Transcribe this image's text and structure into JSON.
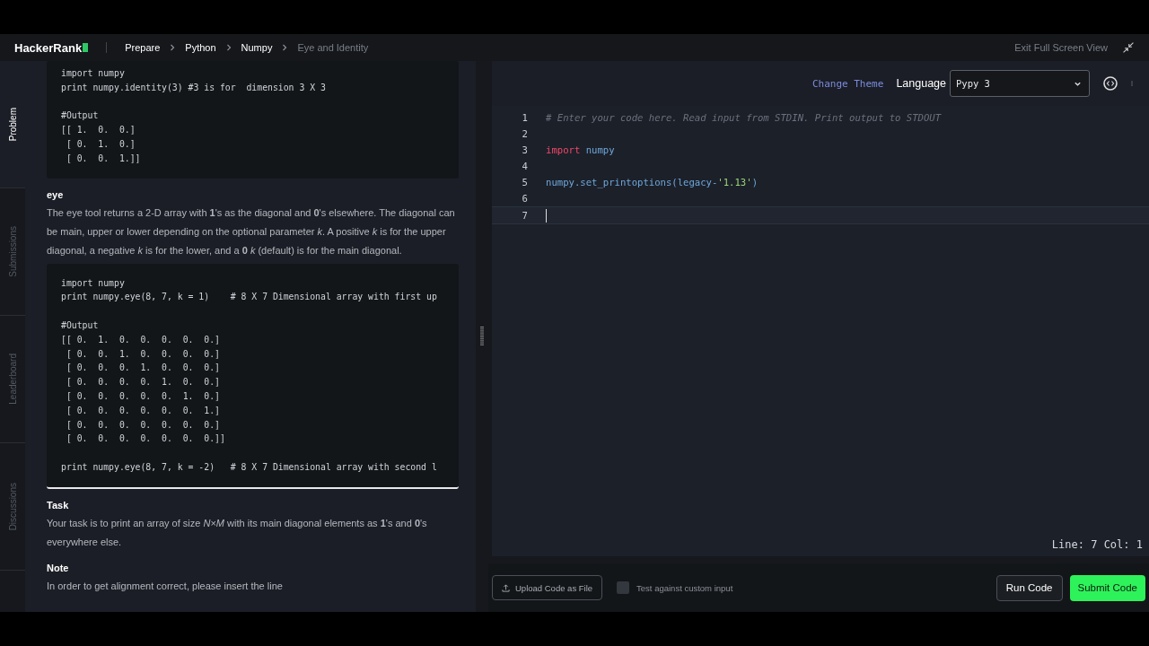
{
  "header": {
    "logo": "HackerRank",
    "breadcrumbs": [
      {
        "label": "Prepare",
        "current": false
      },
      {
        "label": "Python",
        "current": false
      },
      {
        "label": "Numpy",
        "current": false
      },
      {
        "label": "Eye and Identity",
        "current": true
      }
    ],
    "exit_label": "Exit Full Screen View"
  },
  "side_tabs": [
    {
      "label": "Problem",
      "selected": true
    },
    {
      "label": "Submissions",
      "selected": false
    },
    {
      "label": "Leaderboard",
      "selected": false
    },
    {
      "label": "Discussions",
      "selected": false
    }
  ],
  "problem": [
    {
      "kind": "code",
      "text": "import numpy\nprint numpy.identity(3) #3 is for  dimension 3 X 3\n\n#Output\n[[ 1.  0.  0.]\n [ 0.  1.  0.]\n [ 0.  0.  1.]]"
    },
    {
      "kind": "heading",
      "text": "eye"
    },
    {
      "kind": "para",
      "text": "The eye tool returns a 2-D array with **1**'s as the diagonal and **0**'s elsewhere. The diagonal can be main, upper or lower depending on the optional parameter *k*. A positive *k* is for the upper diagonal, a negative *k* is for the lower, and a **0** *k* (default) is for the main diagonal."
    },
    {
      "kind": "code",
      "text": "import numpy\nprint numpy.eye(8, 7, k = 1)    # 8 X 7 Dimensional array with first up\n\n#Output\n[[ 0.  1.  0.  0.  0.  0.  0.]\n [ 0.  0.  1.  0.  0.  0.  0.]\n [ 0.  0.  0.  1.  0.  0.  0.]\n [ 0.  0.  0.  0.  1.  0.  0.]\n [ 0.  0.  0.  0.  0.  1.  0.]\n [ 0.  0.  0.  0.  0.  0.  1.]\n [ 0.  0.  0.  0.  0.  0.  0.]\n [ 0.  0.  0.  0.  0.  0.  0.]]\n\nprint numpy.eye(8, 7, k = -2)   # 8 X 7 Dimensional array with second l"
    },
    {
      "kind": "heading",
      "text": "Task"
    },
    {
      "kind": "para",
      "text": "Your task is to print an array of size *N*×*M* with its main diagonal elements as **1**'s and **0**'s everywhere else."
    },
    {
      "kind": "heading",
      "text": "Note"
    },
    {
      "kind": "para",
      "text": "In order to get alignment correct, please insert the line"
    }
  ],
  "toolbar": {
    "change_theme": "Change Theme",
    "language_label": "Language",
    "language": "Pypy 3"
  },
  "editor": {
    "lines": [
      {
        "number": "1",
        "cursor": false,
        "tokens": [
          {
            "kind": "comment",
            "text": "# Enter your code here. Read input from STDIN. Print output to STDOUT"
          }
        ]
      },
      {
        "number": "2",
        "cursor": false
      },
      {
        "number": "3",
        "cursor": false,
        "tokens": [
          {
            "kind": "keyword",
            "text": "import"
          },
          {
            "kind": "plain",
            "text": " numpy"
          }
        ]
      },
      {
        "number": "4",
        "cursor": false
      },
      {
        "number": "5",
        "cursor": false,
        "tokens": [
          {
            "kind": "plain",
            "text": "numpy.set_printoptions(legacy-"
          },
          {
            "kind": "string",
            "text": "'1.13'"
          },
          {
            "kind": "plain",
            "text": ")"
          }
        ]
      },
      {
        "number": "6",
        "cursor": false
      },
      {
        "number": "7",
        "cursor": true
      }
    ],
    "status": "Line: 7 Col: 1"
  },
  "footer": {
    "upload": "Upload Code as File",
    "custom_input": {
      "label": "Test against custom input",
      "checked": false
    },
    "run": "Run Code",
    "submit": "Submit Code"
  }
}
